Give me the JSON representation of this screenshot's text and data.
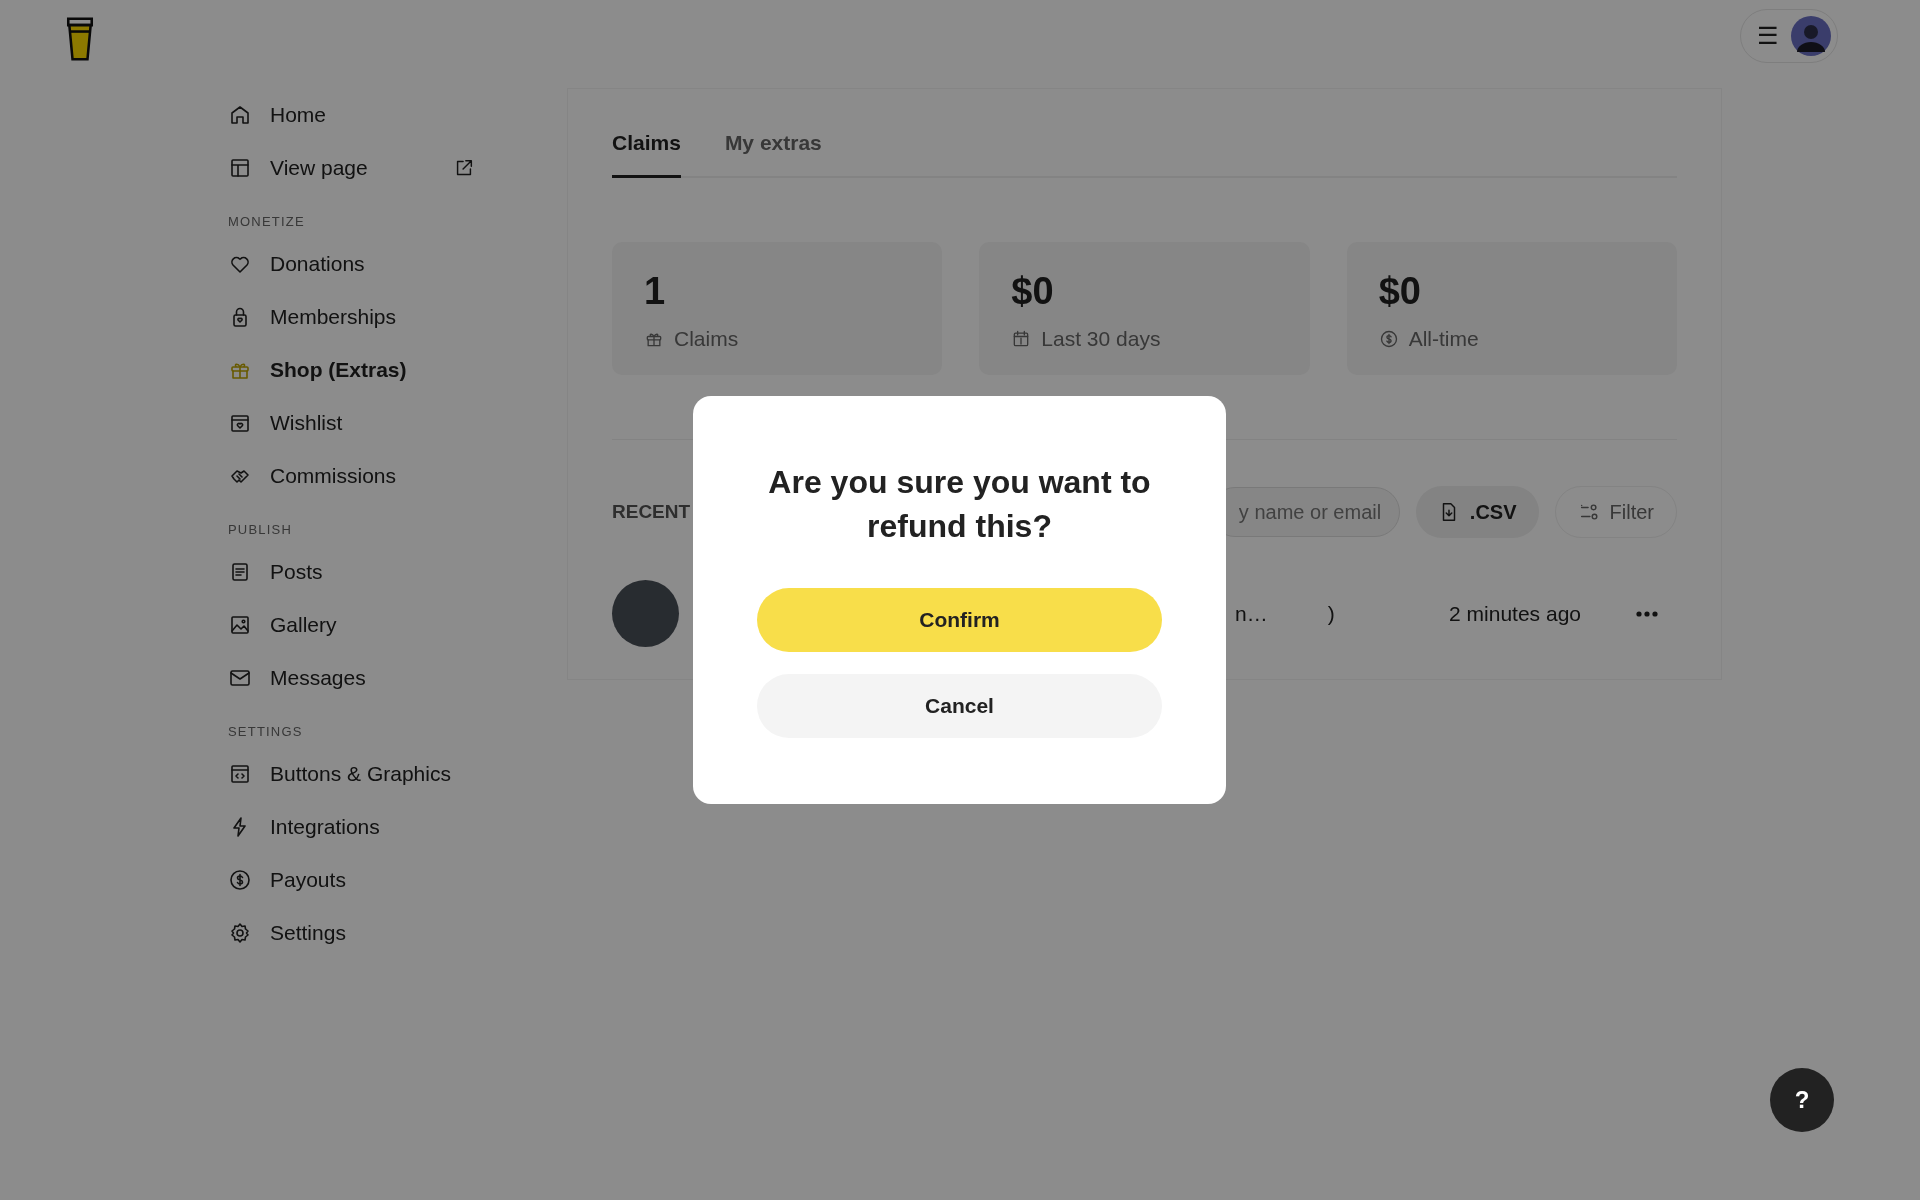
{
  "header": {
    "menu_label": "☰"
  },
  "sidebar": {
    "sections": [
      {
        "items": [
          {
            "label": "Home",
            "kind": "home",
            "selected": false,
            "external": false
          },
          {
            "label": "View page",
            "kind": "layout",
            "selected": false,
            "external": true
          }
        ]
      },
      {
        "title": "MONETIZE",
        "items": [
          {
            "label": "Donations",
            "kind": "heart",
            "selected": false,
            "external": false
          },
          {
            "label": "Memberships",
            "kind": "lock",
            "selected": false,
            "external": false
          },
          {
            "label": "Shop (Extras)",
            "kind": "gift",
            "selected": true,
            "external": false
          },
          {
            "label": "Wishlist",
            "kind": "wish",
            "selected": false,
            "external": false
          },
          {
            "label": "Commissions",
            "kind": "hands",
            "selected": false,
            "external": false
          }
        ]
      },
      {
        "title": "PUBLISH",
        "items": [
          {
            "label": "Posts",
            "kind": "doc",
            "selected": false,
            "external": false
          },
          {
            "label": "Gallery",
            "kind": "image",
            "selected": false,
            "external": false
          },
          {
            "label": "Messages",
            "kind": "mail",
            "selected": false,
            "external": false
          }
        ]
      },
      {
        "title": "SETTINGS",
        "items": [
          {
            "label": "Buttons & Graphics",
            "kind": "code",
            "selected": false,
            "external": false
          },
          {
            "label": "Integrations",
            "kind": "bolt",
            "selected": false,
            "external": false
          },
          {
            "label": "Payouts",
            "kind": "dollar",
            "selected": false,
            "external": false
          },
          {
            "label": "Settings",
            "kind": "gear",
            "selected": false,
            "external": false
          }
        ]
      }
    ]
  },
  "tabs": [
    {
      "label": "Claims",
      "selected": true
    },
    {
      "label": "My extras",
      "selected": false
    }
  ],
  "stats": [
    {
      "value": "1",
      "label": "Claims",
      "kind": "gift"
    },
    {
      "value": "$0",
      "label": "Last 30 days",
      "kind": "calendar"
    },
    {
      "value": "$0",
      "label": "All-time",
      "kind": "dollar"
    }
  ],
  "recent": {
    "title": "RECENT",
    "search": {
      "placeholder": "y name or email"
    },
    "csv_button": ".CSV",
    "filter_button": "Filter",
    "rows": [
      {
        "name": "n…",
        "column_2": ")",
        "time": "2 minutes ago"
      }
    ]
  },
  "modal": {
    "title": "Are you sure you want to refund this?",
    "confirm": "Confirm",
    "cancel": "Cancel"
  },
  "help_button": "?"
}
